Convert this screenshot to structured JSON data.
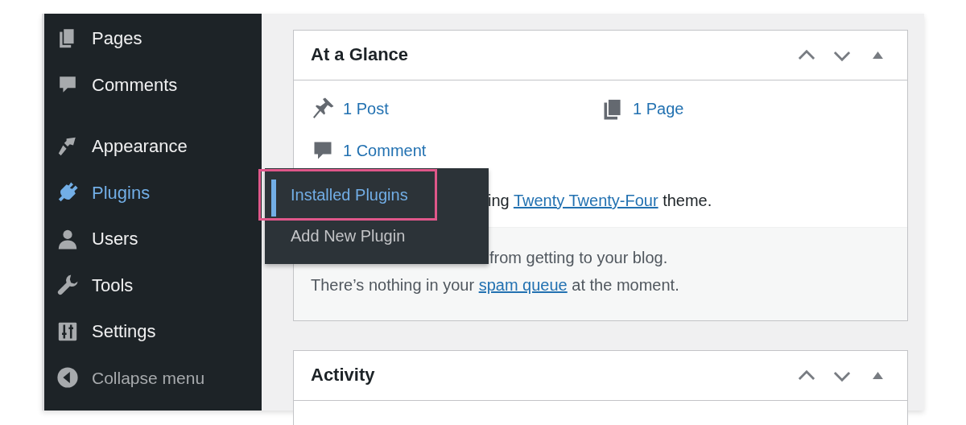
{
  "sidebar": {
    "items": [
      {
        "label": "Pages",
        "kind": "link",
        "selected": false
      },
      {
        "label": "Comments",
        "kind": "link",
        "selected": false
      },
      {
        "label": "Appearance",
        "kind": "link",
        "selected": false
      },
      {
        "label": "Plugins",
        "kind": "link",
        "selected": true
      },
      {
        "label": "Users",
        "kind": "link",
        "selected": false
      },
      {
        "label": "Tools",
        "kind": "link",
        "selected": false
      },
      {
        "label": "Settings",
        "kind": "link",
        "selected": false
      },
      {
        "label": "Collapse menu",
        "kind": "collapse",
        "selected": false
      }
    ]
  },
  "flyout": {
    "items": [
      {
        "label": "Installed Plugins",
        "selected": true,
        "highlighted": true
      },
      {
        "label": "Add New Plugin",
        "selected": false,
        "highlighted": false
      }
    ]
  },
  "widgets": [
    {
      "title": "At a Glance",
      "stats": [
        {
          "text": "1 Post"
        },
        {
          "text": "1 Page"
        },
        {
          "text": "1 Comment"
        }
      ],
      "theme_line": {
        "before": "ing",
        "link": "Twenty Twenty-Four",
        "after": "theme."
      },
      "notes": [
        {
          "before": "from getting to your blog."
        },
        {
          "before": "There’s nothing in your",
          "link": "spam queue",
          "after": "at the moment."
        }
      ]
    },
    {
      "title": "Activity"
    }
  ]
}
